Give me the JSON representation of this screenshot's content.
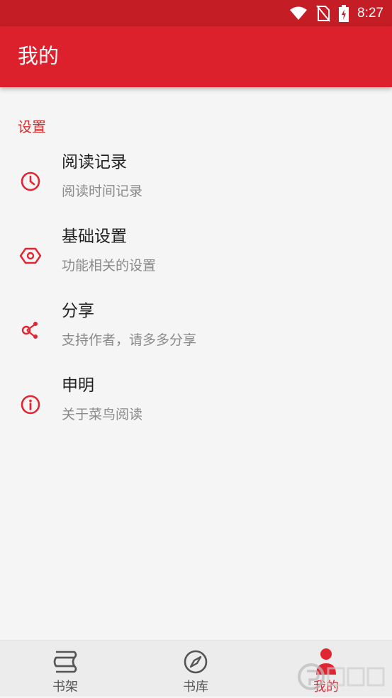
{
  "status_bar": {
    "time": "8:27",
    "icons": [
      "wifi-icon",
      "no-sim-icon",
      "battery-charging-icon"
    ]
  },
  "app_bar": {
    "title": "我的"
  },
  "settings": {
    "section_title": "设置",
    "items": [
      {
        "title": "阅读记录",
        "subtitle": "阅读时间记录",
        "icon": "clock-icon"
      },
      {
        "title": "基础设置",
        "subtitle": "功能相关的设置",
        "icon": "settings-hex-icon"
      },
      {
        "title": "分享",
        "subtitle": "支持作者，请多多分享",
        "icon": "share-icon"
      },
      {
        "title": "申明",
        "subtitle": "关于菜鸟阅读",
        "icon": "info-icon"
      }
    ]
  },
  "bottom_nav": {
    "items": [
      {
        "label": "书架",
        "icon": "bookshelf-icon",
        "active": false
      },
      {
        "label": "书库",
        "icon": "compass-icon",
        "active": false
      },
      {
        "label": "我的",
        "icon": "person-icon",
        "active": true
      }
    ]
  },
  "colors": {
    "status_bar": "#c41d26",
    "app_bar": "#dc212d",
    "accent": "#e22631",
    "background": "#f5f5f5",
    "bottom_nav": "#ececec"
  }
}
